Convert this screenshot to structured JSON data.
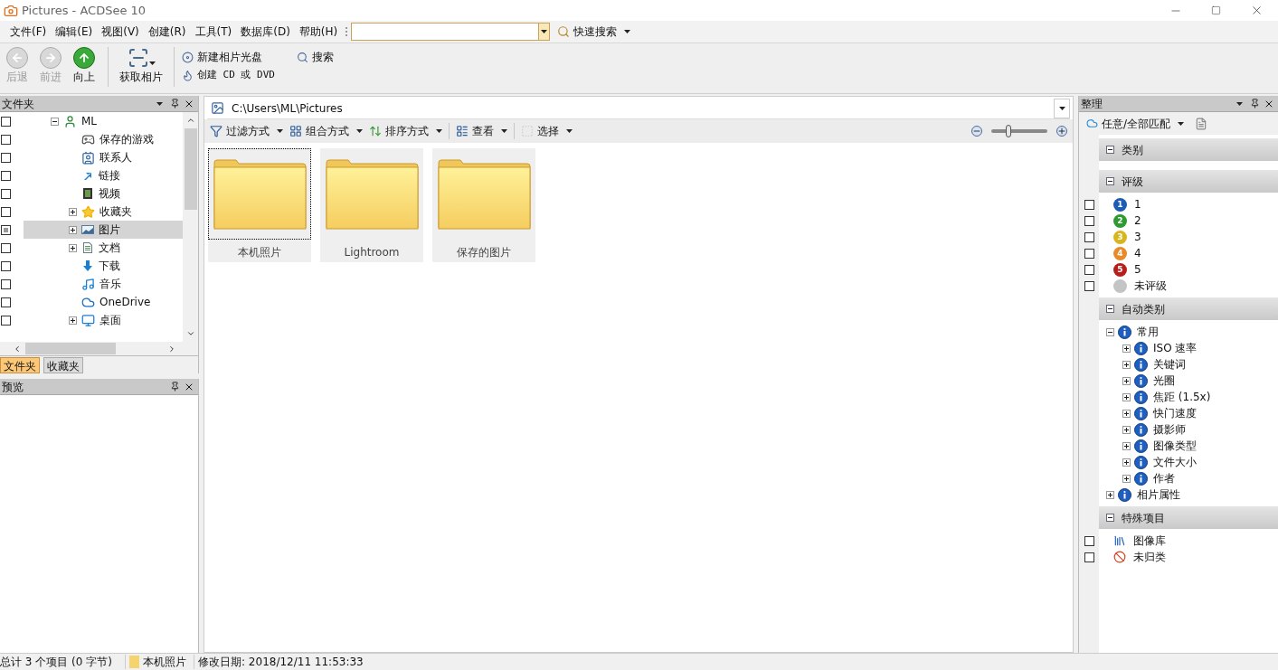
{
  "window": {
    "title": "Pictures - ACDSee 10"
  },
  "menu": [
    "文件(F)",
    "编辑(E)",
    "视图(V)",
    "创建(R)",
    "工具(T)",
    "数据库(D)",
    "帮助(H)"
  ],
  "quick_search": {
    "label": "快速搜索"
  },
  "toolbar": {
    "nav": [
      {
        "label": "后退",
        "kind": "back",
        "disabled": true
      },
      {
        "label": "前进",
        "kind": "forward",
        "disabled": true
      },
      {
        "label": "向上",
        "kind": "up",
        "disabled": false
      }
    ],
    "acquire": "获取相片",
    "links": [
      {
        "label": "新建相片光盘",
        "kind": "disc"
      },
      {
        "label": "创建 CD 或 DVD",
        "kind": "burn"
      },
      {
        "label": "搜索",
        "kind": "search"
      }
    ]
  },
  "folders_panel": {
    "title": "文件夹",
    "tree": [
      {
        "label": "ML",
        "kind": "user",
        "expanded": true,
        "mixed": false,
        "selected": false,
        "children": [
          {
            "label": "保存的游戏",
            "kind": "games",
            "mixed": false,
            "selected": false
          },
          {
            "label": "联系人",
            "kind": "contacts",
            "mixed": false,
            "selected": false
          },
          {
            "label": "链接",
            "kind": "link",
            "mixed": false,
            "selected": false
          },
          {
            "label": "视频",
            "kind": "video",
            "mixed": false,
            "selected": false
          },
          {
            "label": "收藏夹",
            "kind": "star",
            "expanded": false,
            "mixed": false,
            "selected": false
          },
          {
            "label": "图片",
            "kind": "pictures",
            "expanded": false,
            "mixed": true,
            "selected": true
          },
          {
            "label": "文档",
            "kind": "documents",
            "expanded": false,
            "mixed": false,
            "selected": false
          },
          {
            "label": "下载",
            "kind": "download",
            "mixed": false,
            "selected": false
          },
          {
            "label": "音乐",
            "kind": "music",
            "mixed": false,
            "selected": false
          },
          {
            "label": "OneDrive",
            "kind": "cloud",
            "mixed": false,
            "selected": false
          },
          {
            "label": "桌面",
            "kind": "desktop",
            "expanded": false,
            "mixed": false,
            "selected": false
          }
        ]
      }
    ],
    "tabs": [
      {
        "label": "文件夹",
        "selected": true
      },
      {
        "label": "收藏夹",
        "selected": false
      }
    ]
  },
  "preview_panel": {
    "title": "预览"
  },
  "browser": {
    "path": "C:\\Users\\ML\\Pictures",
    "tools": [
      {
        "label": "过滤方式",
        "kind": "filter"
      },
      {
        "label": "组合方式",
        "kind": "group"
      },
      {
        "label": "排序方式",
        "kind": "sort"
      },
      {
        "label": "查看",
        "kind": "view"
      },
      {
        "label": "选择",
        "kind": "select"
      }
    ],
    "zoom": {
      "level": 0.3
    },
    "items": [
      {
        "label": "本机照片",
        "focused": true
      },
      {
        "label": "Lightroom",
        "focused": false
      },
      {
        "label": "保存的图片",
        "focused": false
      }
    ]
  },
  "organize_panel": {
    "title": "整理",
    "match": "任意/全部匹配",
    "sections": [
      {
        "title": "类别",
        "kind": "empty",
        "expanded": true
      },
      {
        "title": "评级",
        "kind": "checklist",
        "expanded": true,
        "items": [
          {
            "label": "1",
            "badge": "1",
            "color": "#1c5cb5",
            "checked": false
          },
          {
            "label": "2",
            "badge": "2",
            "color": "#2e9a32",
            "checked": false
          },
          {
            "label": "3",
            "badge": "3",
            "color": "#d8b51c",
            "checked": false
          },
          {
            "label": "4",
            "badge": "4",
            "color": "#e88a2a",
            "checked": false
          },
          {
            "label": "5",
            "badge": "5",
            "color": "#b5201c",
            "checked": false
          },
          {
            "label": "未评级",
            "color": "#c4c4c4",
            "checked": false
          }
        ]
      },
      {
        "title": "自动类别",
        "kind": "tree",
        "expanded": true,
        "tree": [
          {
            "label": "常用",
            "expanded": true,
            "children": [
              {
                "label": "ISO 速率",
                "expanded": false
              },
              {
                "label": "关键词",
                "expanded": false
              },
              {
                "label": "光圈",
                "expanded": false
              },
              {
                "label": "焦距 (1.5x)",
                "expanded": false
              },
              {
                "label": "快门速度",
                "expanded": false
              },
              {
                "label": "摄影师",
                "expanded": false
              },
              {
                "label": "图像类型",
                "expanded": false
              },
              {
                "label": "文件大小",
                "expanded": false
              },
              {
                "label": "作者",
                "expanded": false
              }
            ]
          },
          {
            "label": "相片属性",
            "expanded": false
          }
        ]
      },
      {
        "title": "特殊项目",
        "kind": "special",
        "expanded": true,
        "items": [
          {
            "label": "图像库",
            "kind": "library",
            "checked": false
          },
          {
            "label": "未归类",
            "kind": "uncategorized",
            "checked": false
          }
        ]
      }
    ]
  },
  "status_bar": {
    "total": "总计 3 个项目 (0 字节)",
    "folder": "本机照片",
    "modified": "修改日期: 2018/12/11 11:53:33"
  }
}
